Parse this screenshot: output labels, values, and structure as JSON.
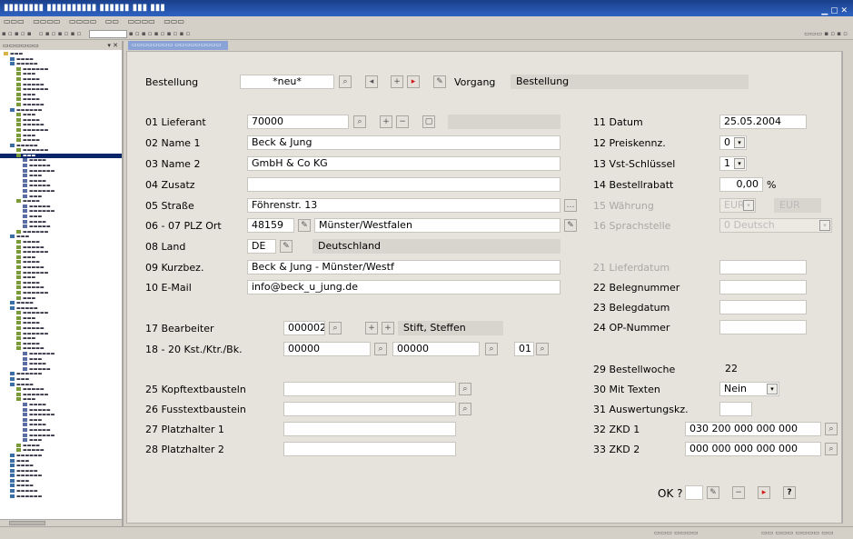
{
  "colors": {
    "titlebar": "#2e63c2",
    "selection": "#0a246a",
    "form_bg": "#e6e3dc",
    "accent_red": "#d31a1a"
  },
  "form": {
    "bestellung": {
      "label": "Bestellung",
      "value": "*neu*",
      "vorgang_label": "Vorgang",
      "vorgang_value": "Bestellung"
    },
    "left_fields": [
      {
        "label": "01 Lieferant",
        "value": "70000"
      },
      {
        "label": "02 Name 1",
        "value": "Beck & Jung"
      },
      {
        "label": "03 Name 2",
        "value": "GmbH & Co KG"
      },
      {
        "label": "04 Zusatz",
        "value": ""
      },
      {
        "label": "05 Straße",
        "value": "Föhrenstr. 13"
      },
      {
        "label": "06 - 07 PLZ Ort",
        "value": "48159",
        "value2": "Münster/Westfalen"
      },
      {
        "label": "08 Land",
        "value": "DE",
        "value2": "Deutschland"
      },
      {
        "label": "09 Kurzbez.",
        "value": "Beck & Jung - Münster/Westf"
      },
      {
        "label": "10 E-Mail",
        "value": "info@beck_u_jung.de"
      }
    ],
    "bearbeiter": {
      "label": "17 Bearbeiter",
      "value": "000002",
      "name": "Stift, Steffen"
    },
    "kst": {
      "label": "18 - 20 Kst./Ktr./Bk.",
      "v1": "00000",
      "v2": "00000",
      "v3": "01"
    },
    "text_fields": [
      {
        "label": "25 Kopftextbausteln",
        "value": ""
      },
      {
        "label": "26 Fusstextbaustein",
        "value": ""
      },
      {
        "label": "27 Platzhalter 1",
        "value": ""
      },
      {
        "label": "28 Platzhalter 2",
        "value": ""
      }
    ],
    "right_top": [
      {
        "label": "11 Datum",
        "value": "25.05.2004"
      },
      {
        "label": "12 Preiskennz.",
        "value": "0"
      },
      {
        "label": "13 Vst-Schlüssel",
        "value": "1"
      },
      {
        "label": "14 Bestellrabatt",
        "value": "0,00",
        "unit": "%"
      },
      {
        "label": "15 Währung",
        "value": "EUR",
        "value2": "EUR"
      },
      {
        "label": "16 Sprachstelle",
        "value": "0 Deutsch"
      }
    ],
    "right_mid": [
      {
        "label": "21 Lieferdatum",
        "value": ""
      },
      {
        "label": "22 Belegnummer",
        "value": ""
      },
      {
        "label": "23 Belegdatum",
        "value": ""
      },
      {
        "label": "24 OP-Nummer",
        "value": ""
      }
    ],
    "right_bottom": [
      {
        "label": "29 Bestellwoche",
        "value": "22"
      },
      {
        "label": "30 Mit Texten",
        "value": "Nein"
      },
      {
        "label": "31 Auswertungskz.",
        "value": ""
      },
      {
        "label": "32 ZKD 1",
        "value": "030 200 000 000 000"
      },
      {
        "label": "33 ZKD 2",
        "value": "000 000 000 000 000"
      }
    ],
    "ok_label": "OK ?"
  }
}
